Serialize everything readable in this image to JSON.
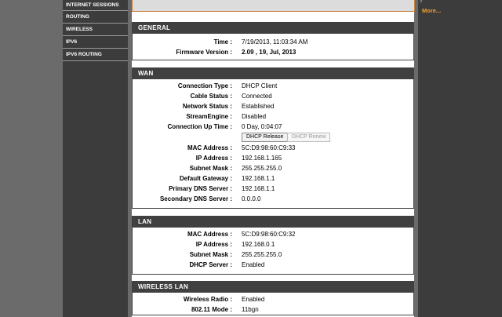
{
  "sidebar": {
    "items": [
      {
        "label": "INTERNET SESSIONS"
      },
      {
        "label": "ROUTING"
      },
      {
        "label": "WIRELESS"
      },
      {
        "label": "IPV6"
      },
      {
        "label": "IPV6 ROUTING"
      }
    ]
  },
  "right": {
    "more": "More...",
    "top_glyph": "?"
  },
  "general": {
    "title": "GENERAL",
    "rows": [
      {
        "label": "Time :",
        "value": "7/19/2013, 11:03:34 AM"
      },
      {
        "label": "Firmware Version :",
        "value": "2.09 , 19, Jul, 2013"
      }
    ]
  },
  "wan": {
    "title": "WAN",
    "rows_top": [
      {
        "label": "Connection Type :",
        "value": "DHCP Client"
      },
      {
        "label": "Cable Status :",
        "value": "Connected"
      },
      {
        "label": "Network Status :",
        "value": "Established"
      },
      {
        "label": "StreamEngine :",
        "value": "Disabled"
      },
      {
        "label": "Connection Up Time :",
        "value": "0 Day, 0:04:07"
      }
    ],
    "buttons": {
      "release": "DHCP Release",
      "renew": "DHCP Renew"
    },
    "rows_bottom": [
      {
        "label": "MAC Address :",
        "value": "5C:D9:98:60:C9:33"
      },
      {
        "label": "IP Address :",
        "value": "192.168.1.165"
      },
      {
        "label": "Subnet Mask :",
        "value": "255.255.255.0"
      },
      {
        "label": "Default Gateway :",
        "value": "192.168.1.1"
      },
      {
        "label": "Primary DNS Server :",
        "value": "192.168.1.1"
      },
      {
        "label": "Secondary DNS Server :",
        "value": "0.0.0.0"
      }
    ]
  },
  "lan": {
    "title": "LAN",
    "rows": [
      {
        "label": "MAC Address :",
        "value": "5C:D9:98:60:C9:32"
      },
      {
        "label": "IP Address :",
        "value": "192.168.0.1"
      },
      {
        "label": "Subnet Mask :",
        "value": "255.255.255.0"
      },
      {
        "label": "DHCP Server :",
        "value": "Enabled"
      }
    ]
  },
  "wireless": {
    "title": "WIRELESS LAN",
    "rows": [
      {
        "label": "Wireless Radio :",
        "value": "Enabled"
      },
      {
        "label": "802.11 Mode :",
        "value": "11bgn"
      }
    ]
  }
}
